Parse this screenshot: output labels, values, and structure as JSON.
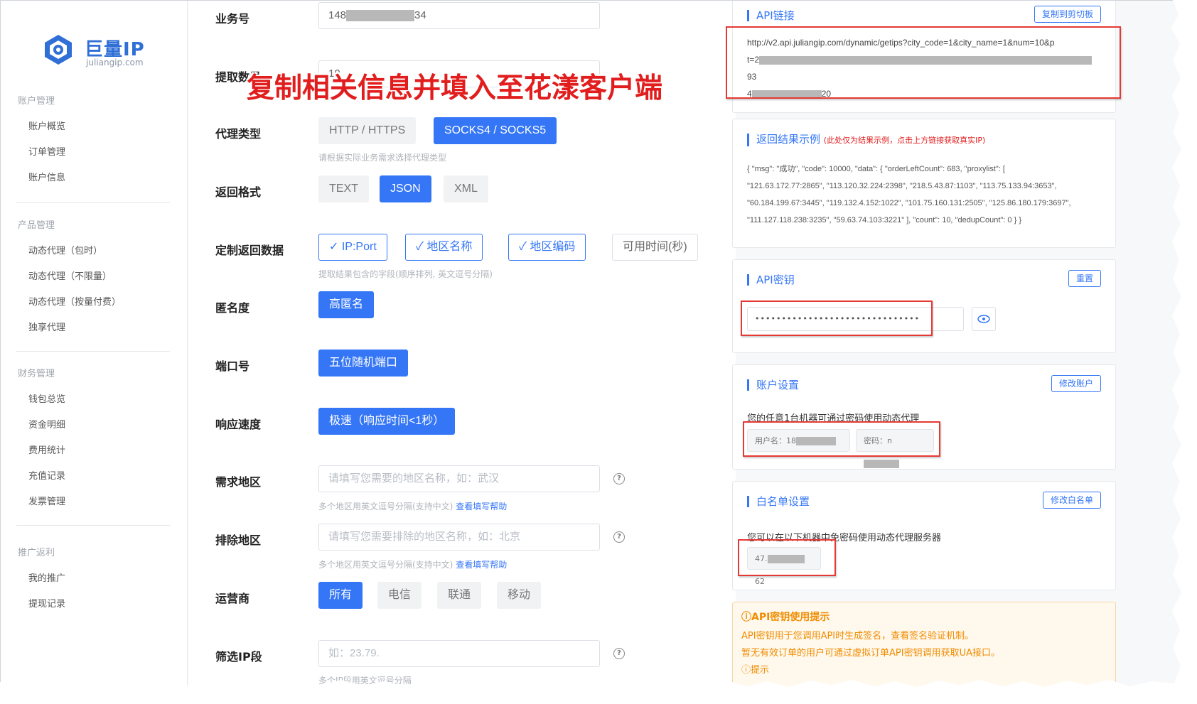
{
  "brand": {
    "name": "巨量IP",
    "domain": "juliangip.com"
  },
  "sidebar": {
    "groups": [
      {
        "title": "账户管理",
        "items": [
          "账户概览",
          "订单管理",
          "账户信息"
        ]
      },
      {
        "title": "产品管理",
        "items": [
          "动态代理（包时）",
          "动态代理（不限量）",
          "动态代理（按量付费）",
          "独享代理"
        ]
      },
      {
        "title": "财务管理",
        "items": [
          "钱包总览",
          "资金明细",
          "费用统计",
          "充值记录",
          "发票管理"
        ]
      },
      {
        "title": "推广返利",
        "items": [
          "我的推广",
          "提现记录"
        ]
      }
    ]
  },
  "overlay": "复制相关信息并填入至花漾客户端",
  "form": {
    "business_no": {
      "label": "业务号",
      "value_start": "148",
      "value_end": "34"
    },
    "quantity": {
      "label": "提取数量",
      "value": "10"
    },
    "proxy_type": {
      "label": "代理类型",
      "options": [
        "HTTP / HTTPS",
        "SOCKS4 / SOCKS5"
      ],
      "selected": "SOCKS4 / SOCKS5",
      "hint": "请根据实际业务需求选择代理类型"
    },
    "return_format": {
      "label": "返回格式",
      "options": [
        "TEXT",
        "JSON",
        "XML"
      ],
      "selected": "JSON"
    },
    "custom_fields": {
      "label": "定制返回数据",
      "options": [
        "IP:Port",
        "地区名称",
        "地区编码",
        "可用时间(秒)"
      ],
      "checked": [
        "IP:Port",
        "地区名称",
        "地区编码"
      ],
      "check_mark": "✓",
      "hint": "提取结果包含的字段(顺序排列, 英文逗号分隔)"
    },
    "anonymity": {
      "label": "匿名度",
      "value": "高匿名"
    },
    "port": {
      "label": "端口号",
      "value": "五位随机端口"
    },
    "speed": {
      "label": "响应速度",
      "value": "极速（响应时间<1秒）"
    },
    "region": {
      "label": "需求地区",
      "placeholder": "请填写您需要的地区名称，如：武汉",
      "hint": "多个地区用英文逗号分隔(支持中文)",
      "help_link": "查看填写帮助"
    },
    "exclude_region": {
      "label": "排除地区",
      "placeholder": "请填写您需要排除的地区名称，如：北京",
      "hint": "多个地区用英文逗号分隔(支持中文)",
      "help_link": "查看填写帮助"
    },
    "isp": {
      "label": "运营商",
      "options": [
        "所有",
        "电信",
        "联通",
        "移动"
      ],
      "selected": "所有"
    },
    "ip_filter": {
      "label": "筛选IP段",
      "placeholder": "如：23.79.",
      "hint": "多个IP段用英文逗号分隔"
    }
  },
  "api_link": {
    "title": "API链接",
    "copy_button": "复制到剪切板",
    "line1": "http://v2.api.juliangip.com/dynamic/getips?city_code=1&city_name=1&num=10&p",
    "line2_start": "t=2",
    "line2_end": "93",
    "line3_start": "4",
    "line3_end": "20"
  },
  "example": {
    "title": "返回结果示例",
    "note": "(此处仅为结果示例，点击上方链接获取真实IP)",
    "lines": [
      "{ \"msg\": \"成功\", \"code\": 10000, \"data\": { \"orderLeftCount\": 683, \"proxylist\": [",
      "\"121.63.172.77:2865\", \"113.120.32.224:2398\", \"218.5.43.87:1103\", \"113.75.133.94:3653\",",
      "\"60.184.199.67:3445\", \"119.132.4.152:1022\", \"101.75.160.131:2505\", \"125.86.180.179:3697\",",
      "\"111.127.118.238:3235\", \"59.63.74.103:3221\" ], \"count\": 10, \"dedupCount\": 0 } }"
    ]
  },
  "api_key": {
    "title": "API密钥",
    "reset_button": "重置",
    "masked": "•••••••••••••••••••••••••••••••"
  },
  "account": {
    "title": "账户设置",
    "edit_button": "修改账户",
    "desc": "您的任意1台机器可通过密码使用动态代理",
    "username_label": "用户名：18",
    "password_label": "密码：n"
  },
  "whitelist": {
    "title": "白名单设置",
    "edit_button": "修改白名单",
    "desc": "您可以在以下机器中免密码使用动态代理服务器",
    "ip_start": "47.",
    "ip_end": "62"
  },
  "notice": {
    "title": "API密钥使用提示",
    "lines": [
      "API密钥用于您调用API时生成签名，查看签名验证机制。",
      "暂无有效订单的用户可通过虚拟订单API密钥调用获取UA接口。"
    ],
    "last_fragment": "提示"
  },
  "colors": {
    "primary": "#3476f6",
    "annotation_red": "#e53935",
    "warning": "#f08c00"
  }
}
